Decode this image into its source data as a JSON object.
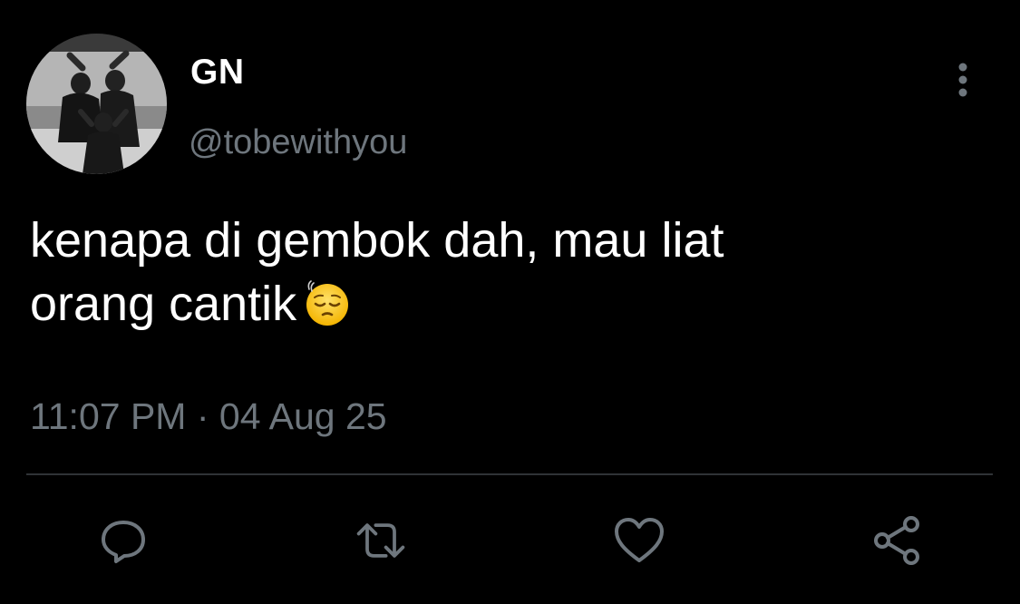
{
  "user": {
    "display_name": "GN",
    "handle": "@tobewithyou",
    "avatar": "profile-photo"
  },
  "tweet": {
    "text_line1": "kenapa di gembok dah, mau liat",
    "text_line2": "orang cantik",
    "emoji": "pensive-face-emoji",
    "time": "11:07 PM",
    "separator": "·",
    "date": "04 Aug 25"
  },
  "actions": {
    "reply": "reply-icon",
    "retweet": "retweet-icon",
    "like": "heart-icon",
    "share": "share-icon",
    "more": "more-options-icon"
  },
  "colors": {
    "background": "#000000",
    "primary_text": "#ffffff",
    "secondary_text": "#6e767d",
    "divider": "#2f3336",
    "icon": "#6e767d"
  }
}
